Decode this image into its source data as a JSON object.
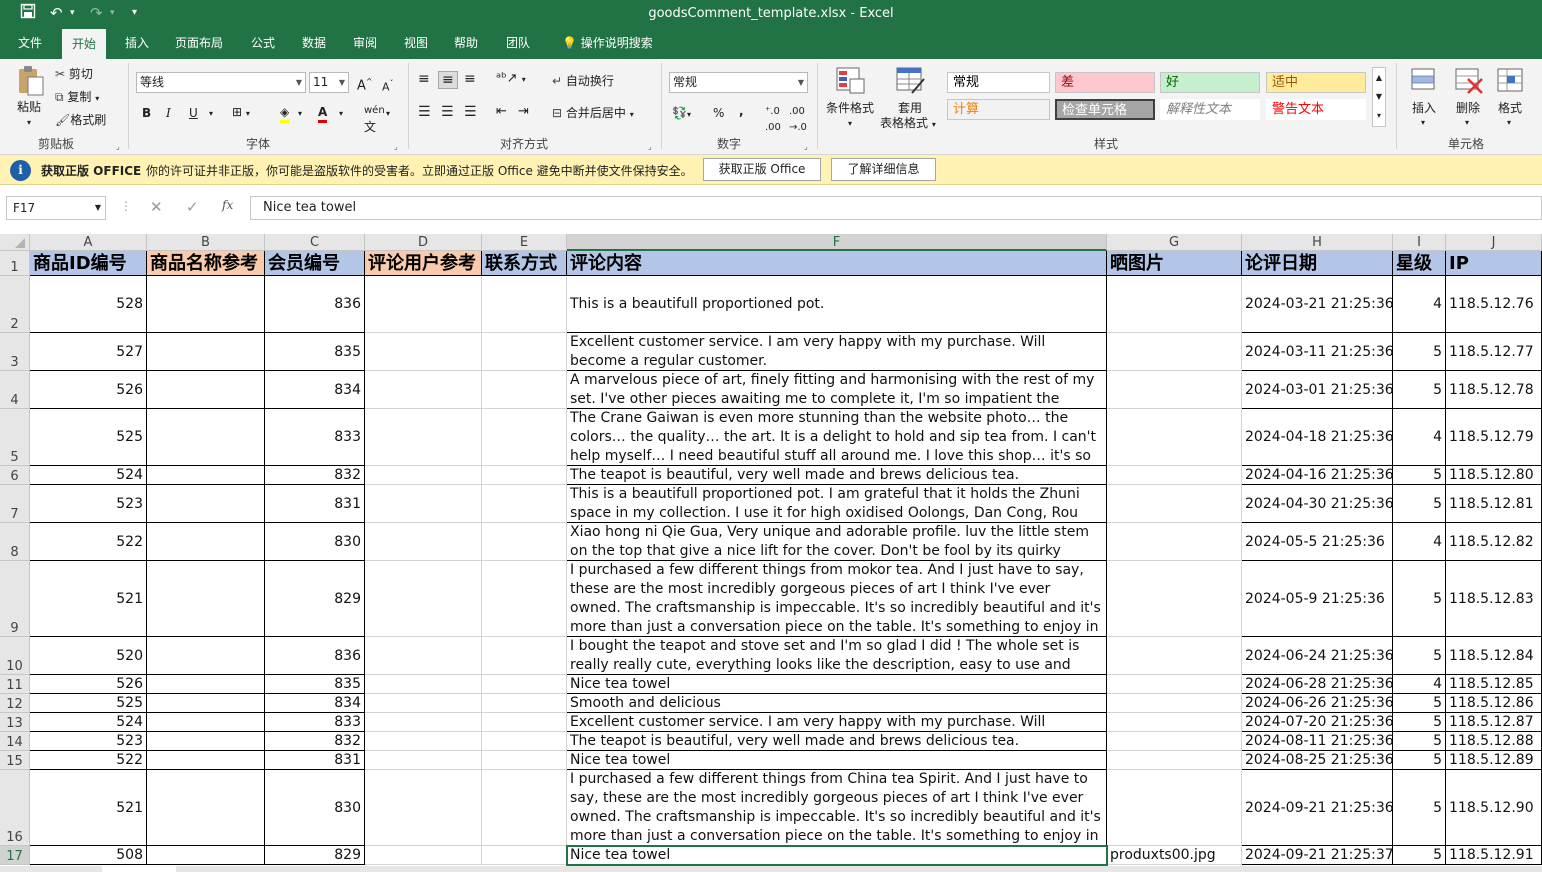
{
  "window": {
    "title": "goodsComment_template.xlsx  -  Excel"
  },
  "quick_access": {
    "save_icon": "save-icon",
    "undo_icon": "undo-icon",
    "redo_icon": "redo-icon",
    "customize": "▾"
  },
  "tabs": [
    "文件",
    "开始",
    "插入",
    "页面布局",
    "公式",
    "数据",
    "审阅",
    "视图",
    "帮助",
    "团队"
  ],
  "active_tab": "开始",
  "tell_me": "操作说明搜索",
  "ribbon": {
    "clipboard": {
      "paste": "粘贴",
      "cut": "剪切",
      "copy": "复制",
      "format_painter": "格式刷",
      "label": "剪贴板"
    },
    "font": {
      "name": "等线",
      "size": "11",
      "label": "字体",
      "bold": "B",
      "italic": "I",
      "underline": "U",
      "wen": "wén"
    },
    "alignment": {
      "wrap": "自动换行",
      "merge": "合并后居中",
      "label": "对齐方式"
    },
    "number": {
      "format": "常规",
      "percent": "%",
      "comma": ",",
      "label": "数字"
    },
    "styles": {
      "cond_format": "条件格式",
      "table_format_1": "套用",
      "table_format_2": "表格格式",
      "label": "样式",
      "cells": [
        {
          "text": "常规",
          "bg": "#ffffff",
          "color": "#000000"
        },
        {
          "text": "差",
          "bg": "#ffc7ce",
          "color": "#9c0006"
        },
        {
          "text": "好",
          "bg": "#c6efce",
          "color": "#006100"
        },
        {
          "text": "适中",
          "bg": "#ffeb9c",
          "color": "#9c5700"
        },
        {
          "text": "计算",
          "bg": "#f2f2f2",
          "color": "#fa7d00"
        },
        {
          "text": "检查单元格",
          "bg": "#a5a5a5",
          "color": "#ffffff"
        },
        {
          "text": "解释性文本",
          "bg": "#ffffff",
          "color": "#7f7f7f"
        },
        {
          "text": "警告文本",
          "bg": "#ffffff",
          "color": "#ff0000"
        }
      ]
    },
    "cells": {
      "insert": "插入",
      "delete": "删除",
      "format": "格式",
      "label": "单元格"
    }
  },
  "message_bar": {
    "title": "获取正版 OFFICE",
    "text": "你的许可证并非正版，你可能是盗版软件的受害者。立即通过正版 Office 避免中断并使文件保持安全。",
    "btn_get": "获取正版 Office",
    "btn_learn": "了解详细信息"
  },
  "formula_bar": {
    "name_box": "F17",
    "formula": "Nice tea towel",
    "fx": "fx"
  },
  "sheet": {
    "selected_cell": "F17",
    "columns": [
      "A",
      "B",
      "C",
      "D",
      "E",
      "F",
      "G",
      "H",
      "I",
      "J"
    ],
    "header_row": [
      {
        "text": "商品ID编号",
        "bg": "#b4c6e7"
      },
      {
        "text": "商品名称参考",
        "bg": "#f8cbad"
      },
      {
        "text": "会员编号",
        "bg": "#b4c6e7"
      },
      {
        "text": "评论用户参考",
        "bg": "#f8cbad"
      },
      {
        "text": "联系方式",
        "bg": "#b4c6e7"
      },
      {
        "text": "评论内容",
        "bg": "#b4c6e7"
      },
      {
        "text": "晒图片",
        "bg": "#b4c6e7"
      },
      {
        "text": "论评日期",
        "bg": "#b4c6e7"
      },
      {
        "text": "星级",
        "bg": "#b4c6e7"
      },
      {
        "text": "IP",
        "bg": "#b4c6e7"
      }
    ],
    "rows": [
      {
        "n": "2",
        "a": "528",
        "c": "836",
        "f": "This is a beautifull proportioned pot.",
        "g": "",
        "h": "2024-03-21 21:25:36",
        "i": "4",
        "j": "118.5.12.76"
      },
      {
        "n": "3",
        "a": "527",
        "c": "835",
        "f": "Excellent customer service. I am very happy with my purchase. Will become a regular customer.",
        "g": "",
        "h": "2024-03-11 21:25:36",
        "i": "5",
        "j": "118.5.12.77"
      },
      {
        "n": "4",
        "a": "526",
        "c": "834",
        "f": "A marvelous piece of art, finely fitting and harmonising with the rest of my set. I've other pieces awaiting me to complete it, I'm so impatient the receive them.",
        "g": "",
        "h": "2024-03-01 21:25:36",
        "i": "5",
        "j": "118.5.12.78"
      },
      {
        "n": "5",
        "a": "525",
        "c": "833",
        "f": "The Crane Gaiwan is even more stunning than the website photo… the colors… the quality… the art. It is a delight to hold and sip tea from. I can't help myself… I need beautiful stuff all around me. I love this shop… it's so fun. Next… I will be exploring",
        "g": "",
        "h": "2024-04-18 21:25:36",
        "i": "4",
        "j": "118.5.12.79"
      },
      {
        "n": "6",
        "a": "524",
        "c": "832",
        "f": "The teapot is beautiful, very well made and brews delicious tea.",
        "g": "",
        "h": "2024-04-16 21:25:36",
        "i": "5",
        "j": "118.5.12.80"
      },
      {
        "n": "7",
        "a": "523",
        "c": "831",
        "f": "This is a beautifull proportioned pot. I am grateful that it holds the Zhuni space in my collection. I use it for high oxidised Oolongs, Dan Cong, Rou Gui etc as it",
        "g": "",
        "h": "2024-04-30 21:25:36",
        "i": "5",
        "j": "118.5.12.81"
      },
      {
        "n": "8",
        "a": "522",
        "c": "830",
        "f": "Xiao hong ni Qie Gua, Very unique and adorable profile. luv the little stem on the top that give a nice lift for the cover. Don't be fool by its quirky outlook, this pot",
        "g": "",
        "h": "2024-05-5 21:25:36",
        "i": "4",
        "j": "118.5.12.82"
      },
      {
        "n": "9",
        "a": "521",
        "c": "829",
        "f": "I purchased a few different things from mokor tea. And I just have to say, these are the most incredibly gorgeous pieces of art I think I've ever owned. The craftsmanship is impeccable. It's so incredibly beautiful and it's more than just a conversation piece on the table. It's something to enjoy in awe. Everything was",
        "g": "",
        "h": "2024-05-9 21:25:36",
        "i": "5",
        "j": "118.5.12.83"
      },
      {
        "n": "10",
        "a": "520",
        "c": "836",
        "f": "I bought the teapot and stove set and I'm so glad I did ! The whole set is really really cute, everything looks like the description, easy to use and care. Everything",
        "g": "",
        "h": "2024-06-24 21:25:36",
        "i": "5",
        "j": "118.5.12.84"
      },
      {
        "n": "11",
        "a": "526",
        "c": "835",
        "f": "Nice tea towel",
        "g": "",
        "h": "2024-06-28 21:25:36",
        "i": "4",
        "j": "118.5.12.85"
      },
      {
        "n": "12",
        "a": "525",
        "c": "834",
        "f": "Smooth and delicious",
        "g": "",
        "h": "2024-06-26 21:25:36",
        "i": "5",
        "j": "118.5.12.86"
      },
      {
        "n": "13",
        "a": "524",
        "c": "833",
        "f": "Excellent customer service. I am very happy with my purchase. Will become a",
        "g": "",
        "h": "2024-07-20 21:25:36",
        "i": "5",
        "j": "118.5.12.87"
      },
      {
        "n": "14",
        "a": "523",
        "c": "832",
        "f": "The teapot is beautiful, very well made and brews delicious tea.",
        "g": "",
        "h": "2024-08-11 21:25:36",
        "i": "5",
        "j": "118.5.12.88"
      },
      {
        "n": "15",
        "a": "522",
        "c": "831",
        "f": "Nice tea towel",
        "g": "",
        "h": "2024-08-25 21:25:36",
        "i": "5",
        "j": "118.5.12.89"
      },
      {
        "n": "16",
        "a": "521",
        "c": "830",
        "f": "I purchased a few different things from China tea Spirit. And I just have to say, these are the most incredibly gorgeous pieces of art I think I've ever owned. The craftsmanship is impeccable. It's so incredibly beautiful and it's more than just a conversation piece on the table. It's something to enjoy in awe. Everything was",
        "g": "",
        "h": "2024-09-21 21:25:36",
        "i": "5",
        "j": "118.5.12.90"
      },
      {
        "n": "17",
        "a": "508",
        "c": "829",
        "f": "Nice tea towel",
        "g": "produxts00.jpg",
        "h": "2024-09-21 21:25:37",
        "i": "5",
        "j": "118.5.12.91"
      }
    ]
  }
}
